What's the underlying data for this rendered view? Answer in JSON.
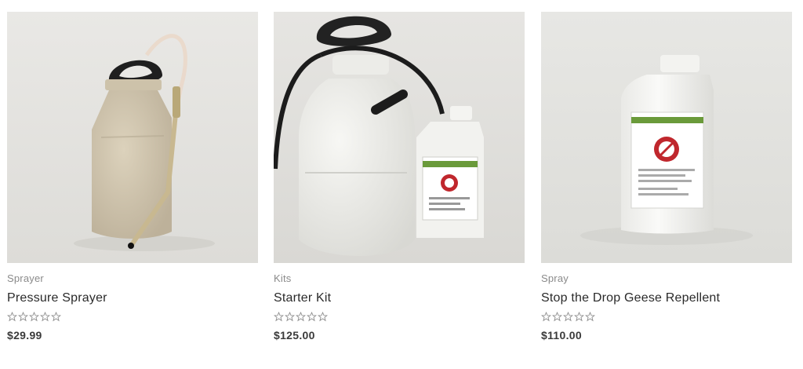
{
  "products": [
    {
      "category": "Sprayer",
      "title": "Pressure Sprayer",
      "price": "$29.99",
      "rating": 0,
      "image_icon": "pressure-sprayer-image"
    },
    {
      "category": "Kits",
      "title": "Starter Kit",
      "price": "$125.00",
      "rating": 0,
      "image_icon": "starter-kit-image"
    },
    {
      "category": "Spray",
      "title": "Stop the Drop Geese Repellent",
      "price": "$110.00",
      "rating": 0,
      "image_icon": "repellent-bottle-image"
    }
  ],
  "colors": {
    "image_bg": "#e7e6e3",
    "star_outline": "#8a8a8a",
    "label_red": "#c0272d",
    "label_green": "#6a9a3a"
  }
}
